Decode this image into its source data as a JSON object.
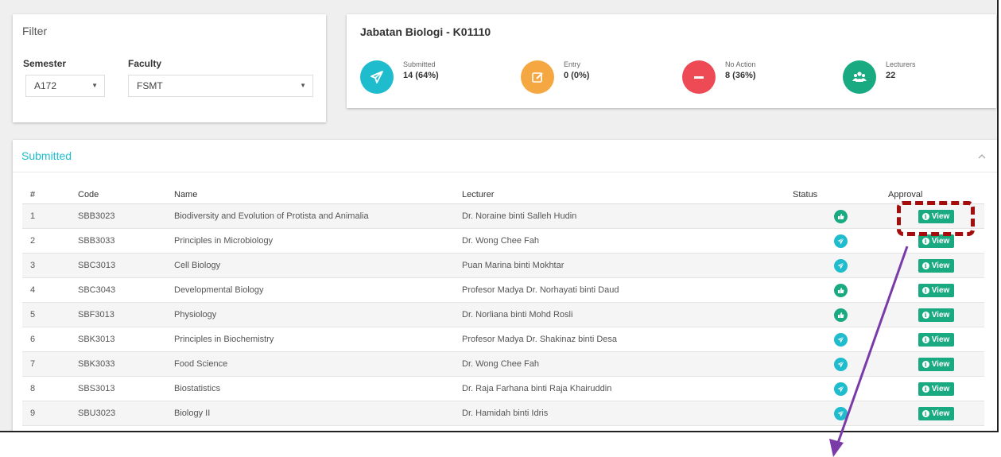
{
  "filter": {
    "title": "Filter",
    "semester_label": "Semester",
    "semester_value": "A172",
    "faculty_label": "Faculty",
    "faculty_value": "FSMT"
  },
  "summary": {
    "department": "Jabatan Biologi - K01110",
    "stats": [
      {
        "label": "Submitted",
        "value": "14 (64%)",
        "color": "#1ebccd",
        "icon": "paper-plane-icon"
      },
      {
        "label": "Entry",
        "value": "0 (0%)",
        "color": "#f5a742",
        "icon": "edit-icon"
      },
      {
        "label": "No Action",
        "value": "8 (36%)",
        "color": "#ee4a56",
        "icon": "minus-icon"
      },
      {
        "label": "Lecturers",
        "value": "22",
        "color": "#1aaa82",
        "icon": "users-icon"
      }
    ]
  },
  "panel": {
    "title": "Submitted",
    "collapse_icon": "chevron-up-icon",
    "columns": [
      "#",
      "Code",
      "Name",
      "Lecturer",
      "Status",
      "Approval"
    ],
    "view_label": "View",
    "rows": [
      {
        "num": "1",
        "code": "SBB3023",
        "name": "Biodiversity and Evolution of Protista and Animalia",
        "lecturer": "Dr. Noraine binti Salleh Hudin",
        "status": "approved"
      },
      {
        "num": "2",
        "code": "SBB3033",
        "name": "Principles in Microbiology",
        "lecturer": "Dr. Wong Chee Fah",
        "status": "submitted"
      },
      {
        "num": "3",
        "code": "SBC3013",
        "name": "Cell Biology",
        "lecturer": "Puan Marina binti Mokhtar",
        "status": "submitted"
      },
      {
        "num": "4",
        "code": "SBC3043",
        "name": "Developmental Biology",
        "lecturer": "Profesor Madya Dr. Norhayati binti Daud",
        "status": "approved"
      },
      {
        "num": "5",
        "code": "SBF3013",
        "name": "Physiology",
        "lecturer": "Dr. Norliana binti Mohd Rosli",
        "status": "approved"
      },
      {
        "num": "6",
        "code": "SBK3013",
        "name": "Principles in Biochemistry",
        "lecturer": "Profesor Madya Dr. Shakinaz binti Desa",
        "status": "submitted"
      },
      {
        "num": "7",
        "code": "SBK3033",
        "name": "Food Science",
        "lecturer": "Dr. Wong Chee Fah",
        "status": "submitted"
      },
      {
        "num": "8",
        "code": "SBS3013",
        "name": "Biostatistics",
        "lecturer": "Dr. Raja Farhana binti Raja Khairuddin",
        "status": "submitted"
      },
      {
        "num": "9",
        "code": "SBU3023",
        "name": "Biology II",
        "lecturer": "Dr. Hamidah binti Idris",
        "status": "submitted"
      }
    ]
  },
  "colors": {
    "accent": "#1ebccd",
    "approved": "#1aaa82",
    "submitted": "#1ebccd",
    "highlight": "#a50d0d",
    "arrow": "#7a3aa8"
  }
}
